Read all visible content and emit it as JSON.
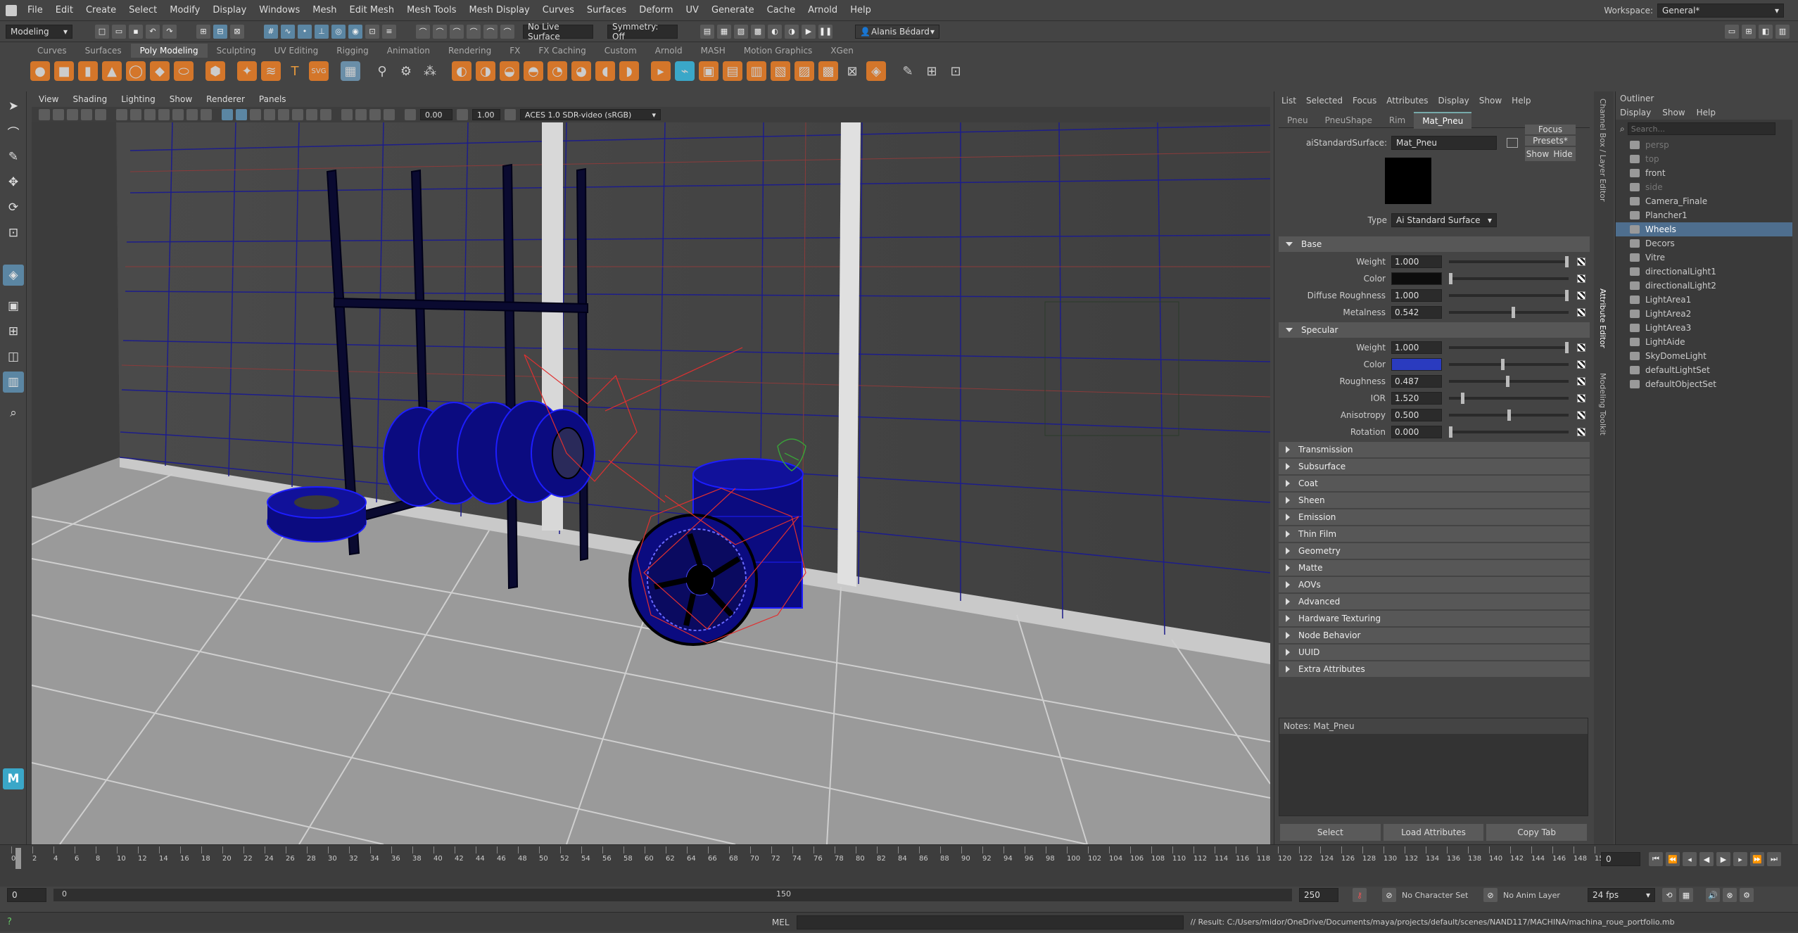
{
  "menubar": {
    "items": [
      "File",
      "Edit",
      "Create",
      "Select",
      "Modify",
      "Display",
      "Windows",
      "Mesh",
      "Edit Mesh",
      "Mesh Tools",
      "Mesh Display",
      "Curves",
      "Surfaces",
      "Deform",
      "UV",
      "Generate",
      "Cache",
      "Arnold",
      "Help"
    ],
    "workspace_label": "Workspace:",
    "workspace_value": "General*"
  },
  "statusline": {
    "mode": "Modeling",
    "live_surface": "No Live Surface",
    "symmetry": "Symmetry: Off",
    "user": "Alanis Bédard"
  },
  "shelf": {
    "tabs": [
      "Curves",
      "Surfaces",
      "Poly Modeling",
      "Sculpting",
      "UV Editing",
      "Rigging",
      "Animation",
      "Rendering",
      "FX",
      "FX Caching",
      "Custom",
      "Arnold",
      "MASH",
      "Motion Graphics",
      "XGen"
    ],
    "active_tab": "Poly Modeling"
  },
  "viewport": {
    "menu": [
      "View",
      "Shading",
      "Lighting",
      "Show",
      "Renderer",
      "Panels"
    ],
    "exposure": "0.00",
    "gamma": "1.00",
    "color_space": "ACES 1.0 SDR-video (sRGB)"
  },
  "attribute_editor": {
    "menu": [
      "List",
      "Selected",
      "Focus",
      "Attributes",
      "Display",
      "Show",
      "Help"
    ],
    "tabs": [
      "Pneu",
      "PneuShape",
      "Rim",
      "Mat_Pneu"
    ],
    "active_tab": "Mat_Pneu",
    "node_type_label": "aiStandardSurface:",
    "node_name": "Mat_Pneu",
    "focus_button": "Focus",
    "presets_button": "Presets*",
    "show_button": "Show",
    "hide_button": "Hide",
    "type_label": "Type",
    "type_value": "Ai Standard Surface",
    "base_section": "Base",
    "base": [
      {
        "label": "Weight",
        "value": "1.000",
        "knob": 1.0
      },
      {
        "label": "Color",
        "color": "#0d0d0d",
        "knob": 0.0
      },
      {
        "label": "Diffuse Roughness",
        "value": "1.000",
        "knob": 1.0
      },
      {
        "label": "Metalness",
        "value": "0.542",
        "knob": 0.54
      }
    ],
    "specular_section": "Specular",
    "specular": [
      {
        "label": "Weight",
        "value": "1.000",
        "knob": 1.0
      },
      {
        "label": "Color",
        "color": "#2a3bbf",
        "knob": 0.45
      },
      {
        "label": "Roughness",
        "value": "0.487",
        "knob": 0.49
      },
      {
        "label": "IOR",
        "value": "1.520",
        "knob": 0.1
      },
      {
        "label": "Anisotropy",
        "value": "0.500",
        "knob": 0.5
      },
      {
        "label": "Rotation",
        "value": "0.000",
        "knob": 0.0
      }
    ],
    "collapsed_sections": [
      "Transmission",
      "Subsurface",
      "Coat",
      "Sheen",
      "Emission",
      "Thin Film",
      "Geometry",
      "Matte",
      "AOVs",
      "Advanced",
      "Hardware Texturing",
      "Node Behavior",
      "UUID",
      "Extra Attributes"
    ],
    "notes_label": "Notes:  Mat_Pneu",
    "buttons": [
      "Select",
      "Load Attributes",
      "Copy Tab"
    ]
  },
  "outliner": {
    "title": "Outliner",
    "menu": [
      "Display",
      "Show",
      "Help"
    ],
    "search_placeholder": "Search...",
    "items": [
      {
        "name": "persp",
        "dim": true
      },
      {
        "name": "top",
        "dim": true
      },
      {
        "name": "front",
        "dim": false
      },
      {
        "name": "side",
        "dim": true
      },
      {
        "name": "Camera_Finale",
        "dim": false
      },
      {
        "name": "Plancher1",
        "dim": false
      },
      {
        "name": "Wheels",
        "dim": false,
        "selected": true
      },
      {
        "name": "Decors",
        "dim": false
      },
      {
        "name": "Vitre",
        "dim": false
      },
      {
        "name": "directionalLight1",
        "dim": false
      },
      {
        "name": "directionalLight2",
        "dim": false
      },
      {
        "name": "LightArea1",
        "dim": false
      },
      {
        "name": "LightArea2",
        "dim": false
      },
      {
        "name": "LightArea3",
        "dim": false
      },
      {
        "name": "LightAide",
        "dim": false
      },
      {
        "name": "SkyDomeLight",
        "dim": false
      },
      {
        "name": "defaultLightSet",
        "dim": false
      },
      {
        "name": "defaultObjectSet",
        "dim": false
      }
    ]
  },
  "timeline": {
    "current_frame": "0",
    "range_start": "0",
    "range_start2": "0",
    "range_end_inner": "150",
    "range_end": "250",
    "character_set": "No Character Set",
    "anim_layer": "No Anim Layer",
    "fps": "24 fps",
    "tick_labels": [
      "0",
      "2",
      "4",
      "6",
      "8",
      "10",
      "12",
      "14",
      "16",
      "18",
      "20",
      "22",
      "24",
      "26",
      "28",
      "30",
      "32",
      "34",
      "36",
      "38",
      "40",
      "42",
      "44",
      "46",
      "48",
      "50",
      "52",
      "54",
      "56",
      "58",
      "60",
      "62",
      "64",
      "66",
      "68",
      "70",
      "72",
      "74",
      "76",
      "78",
      "80",
      "82",
      "84",
      "86",
      "88",
      "90",
      "92",
      "94",
      "96",
      "98",
      "100",
      "102",
      "104",
      "106",
      "108",
      "110",
      "112",
      "114",
      "116",
      "118",
      "120",
      "122",
      "124",
      "126",
      "128",
      "130",
      "132",
      "134",
      "136",
      "138",
      "140",
      "142",
      "144",
      "146",
      "148",
      "150"
    ]
  },
  "cmdline": {
    "lang": "MEL",
    "result": "// Result: C:/Users/midor/OneDrive/Documents/maya/projects/default/scenes/NAND117/MACHINA/machina_roue_portfolio.mb"
  },
  "side_tabs": [
    "Channel Box / Layer Editor",
    "Attribute Editor",
    "Modeling Toolkit"
  ],
  "colors": {
    "accent": "#5b86a3",
    "select": "#4e6e8e",
    "wire": "#1d1d8a",
    "tire": "#0b0b80"
  }
}
